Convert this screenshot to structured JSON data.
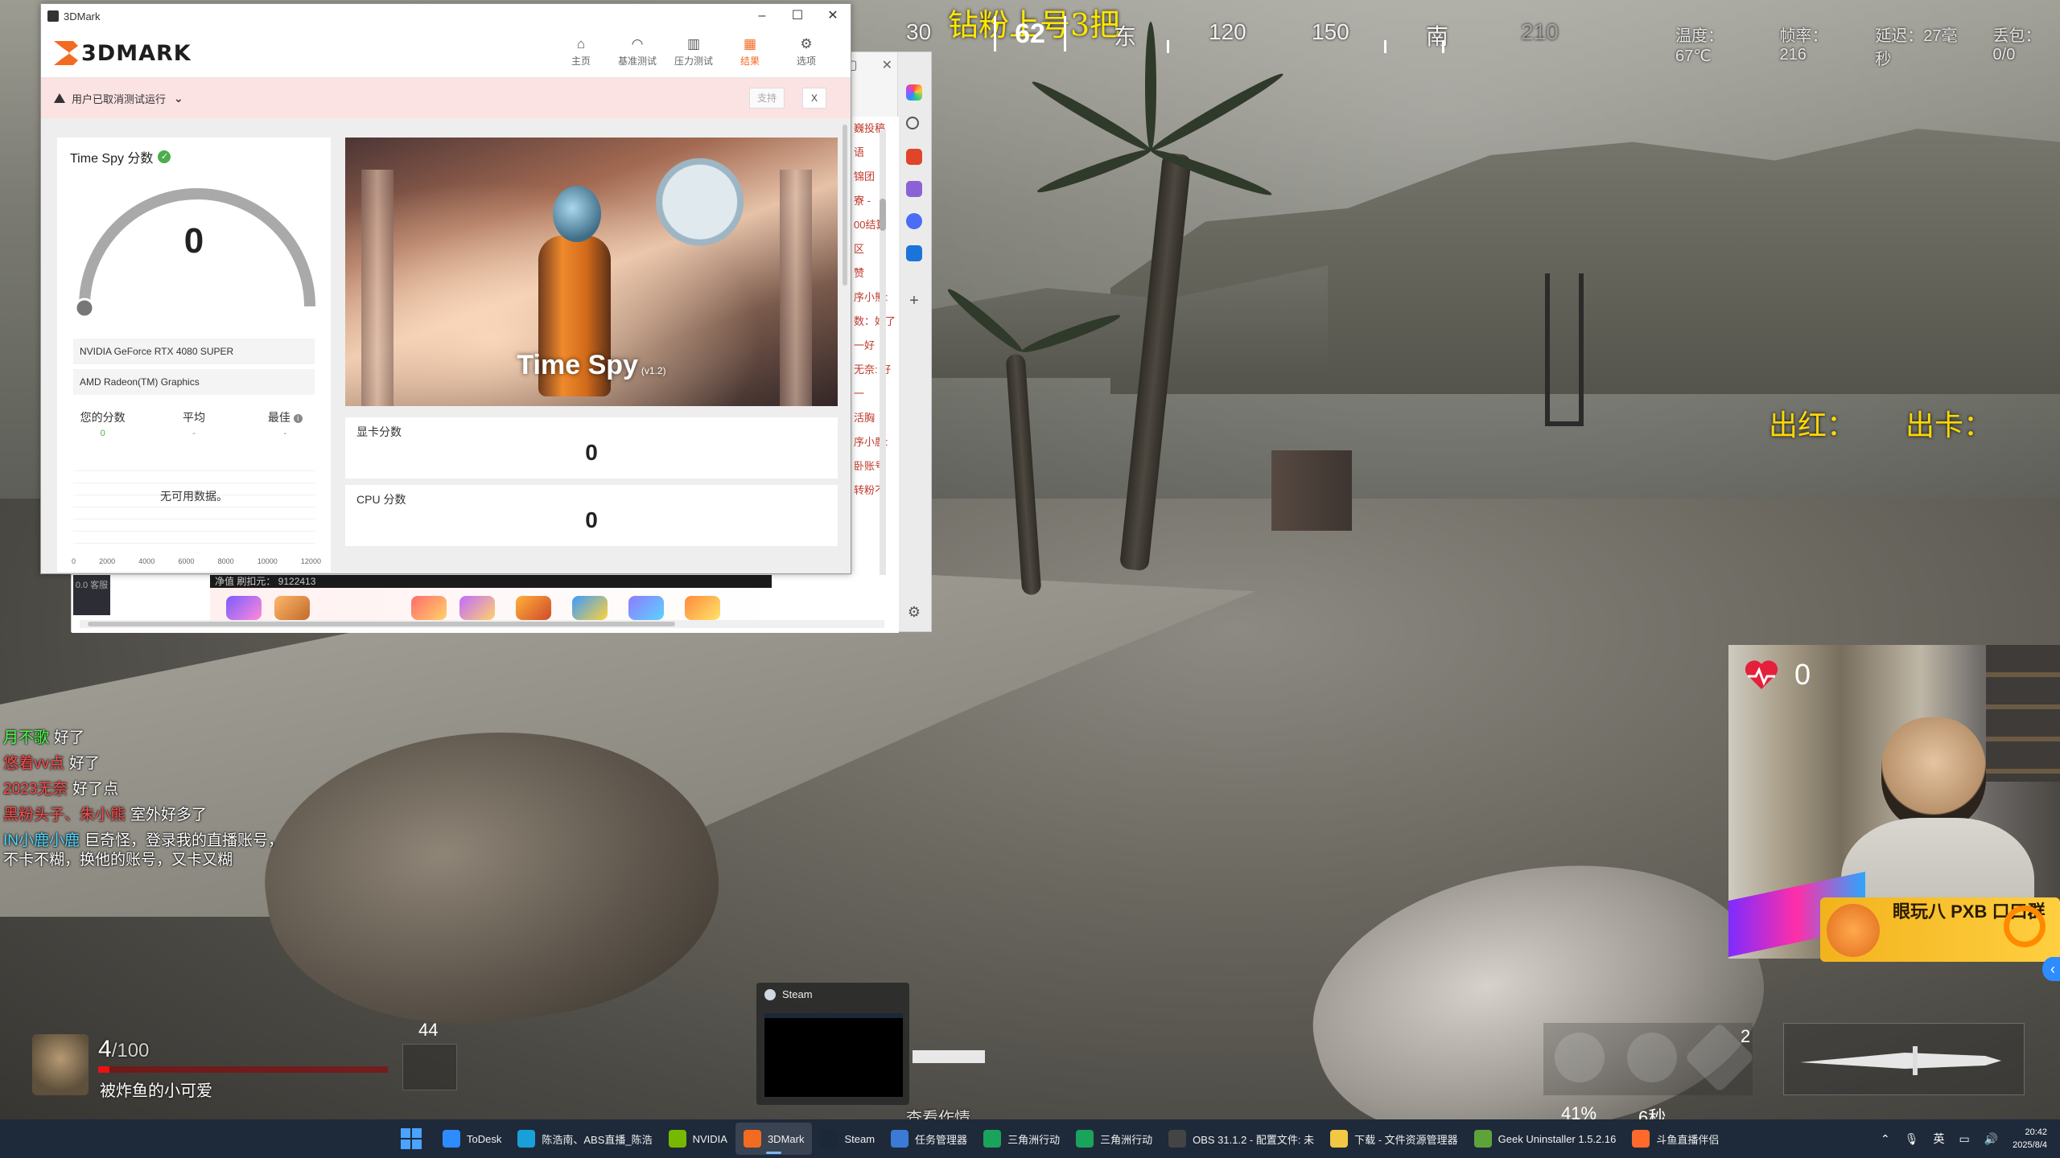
{
  "game": {
    "stream_title": "钻粉上号3把",
    "compass": {
      "bearing": "62",
      "labels": [
        "30",
        "东",
        "120",
        "150",
        "南",
        "210"
      ]
    },
    "stats": {
      "temperature": "温度：67℃",
      "fps": "帧率：216",
      "latency": "延迟：27毫秒",
      "packet_loss": "丢包：0/0"
    },
    "red_card": {
      "red": "出红：",
      "card": "出卡："
    },
    "chat": [
      {
        "name": "月不歌",
        "name_color": "#4cff4c",
        "text": "好了"
      },
      {
        "name": "悠着vv点",
        "name_color": "#ff4c4c",
        "text": "好了"
      },
      {
        "name": "2023无奈",
        "name_color": "#ff4c4c",
        "text": "好了点"
      },
      {
        "name": "黑粉头子、朱小熊",
        "name_color": "#ff4c4c",
        "text": "室外好多了"
      },
      {
        "name": "IN小鹿小鹿",
        "name_color": "#4cd8ff",
        "text": "巨奇怪，登录我的直播账号，"
      },
      {
        "name": "",
        "name_color": "#ffffff",
        "text": "不卡不糊，换他的账号，又卡又糊"
      }
    ],
    "player": {
      "hp": "4",
      "hp_max": "/100",
      "hp_fraction": 0.04,
      "name": "被炸鱼的小可爱",
      "ammo": "44"
    },
    "gadgets": {
      "pct_a": "41%",
      "pct_b": "6秒",
      "count": "2"
    },
    "webcam": {
      "heart_count": "0",
      "promo_text": "眼玩八 PXB 口口群",
      "side_tab": "‹"
    },
    "watch_text": "查看作情"
  },
  "browser": {
    "side_snippets": [
      "巍投稿",
      "语",
      "锦团",
      "寮 -",
      "00结算",
      "区",
      "赞",
      "序小熊:",
      "数：好了",
      "一好",
      "无奈: 好",
      "一",
      "活胸",
      "序小鹿:",
      "卧账号",
      "转粉不"
    ],
    "douyu_bar": "净值 刷扣元： 9122413",
    "left_dark": "0.0 客服"
  },
  "threedmark": {
    "window_title": "3DMark",
    "logo": "3DMARK",
    "nav": [
      {
        "label": "主页",
        "icon": "home-icon"
      },
      {
        "label": "基准测试",
        "icon": "benchmark-icon"
      },
      {
        "label": "压力测试",
        "icon": "stress-icon"
      },
      {
        "label": "结果",
        "icon": "results-icon",
        "active": true
      },
      {
        "label": "选项",
        "icon": "gear-icon"
      }
    ],
    "alert": {
      "text": "用户已取消测试运行",
      "support": "支持",
      "close": "X"
    },
    "score_card": {
      "title": "Time Spy 分数",
      "score": "0",
      "gpu": "NVIDIA GeForce RTX 4080 SUPER",
      "igpu": "AMD Radeon(TM) Graphics",
      "cols": [
        {
          "label": "您的分数",
          "value": "0"
        },
        {
          "label": "平均",
          "value": "-"
        },
        {
          "label": "最佳",
          "value": "-"
        }
      ],
      "no_data": "无可用数据。",
      "axis": [
        "0",
        "2000",
        "4000",
        "6000",
        "8000",
        "10000",
        "12000"
      ]
    },
    "hero": {
      "title": "Time Spy",
      "version": "(v1.2)"
    },
    "gpu_score": {
      "label": "显卡分数",
      "value": "0"
    },
    "cpu_score": {
      "label": "CPU 分数",
      "value": "0"
    }
  },
  "steam_preview": {
    "title": "Steam"
  },
  "taskbar": {
    "items": [
      {
        "label": "ToDesk",
        "color": "#2d8cff"
      },
      {
        "label": "陈浩南、ABS直播_陈浩",
        "color": "#19a0d9"
      },
      {
        "label": "NVIDIA",
        "color": "#76b900"
      },
      {
        "label": "3DMark",
        "color": "#f26b21",
        "active": true
      },
      {
        "label": "Steam",
        "color": "#1b2838"
      },
      {
        "label": "任务管理器",
        "color": "#3b7bd6"
      },
      {
        "label": "三角洲行动",
        "color": "#1aa35b"
      },
      {
        "label": "三角洲行动",
        "color": "#1aa35b"
      },
      {
        "label": "OBS 31.1.2 - 配置文件: 未",
        "color": "#444444"
      },
      {
        "label": "下载 - 文件资源管理器",
        "color": "#f2c744"
      },
      {
        "label": "Geek Uninstaller 1.5.2.16",
        "color": "#5ea33a"
      },
      {
        "label": "斗鱼直播伴侣",
        "color": "#ff6a2c"
      }
    ],
    "tray": {
      "ime": "英",
      "time": "20:42",
      "date": "2025/8/4"
    }
  }
}
